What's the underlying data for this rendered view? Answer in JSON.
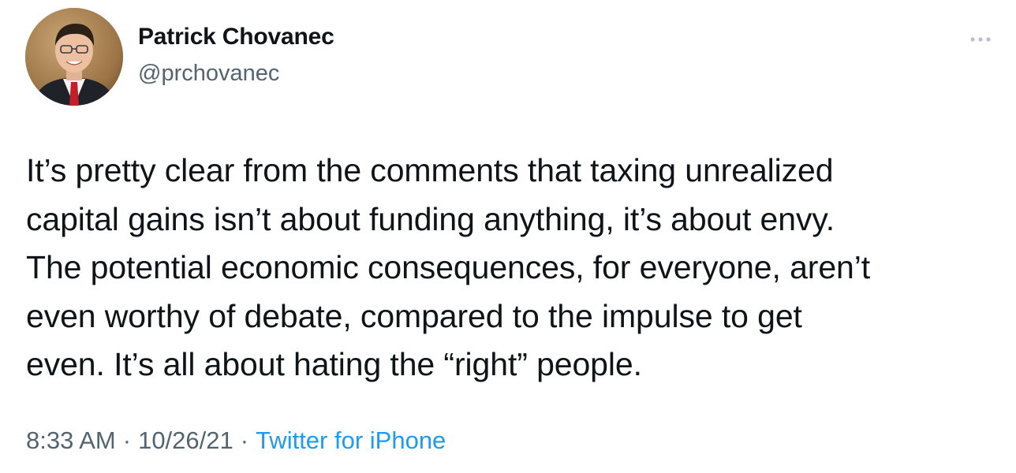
{
  "author": {
    "name": "Patrick Chovanec",
    "handle": "@prchovanec"
  },
  "tweet": {
    "lines": [
      "It’s pretty clear from the comments that taxing unrealized",
      "capital gains isn’t about funding anything, it’s about envy.",
      "The potential economic consequences, for everyone, aren’t",
      "even worthy of debate, compared to the impulse to get",
      "even. It’s all about hating the “right” people."
    ]
  },
  "meta": {
    "time": "8:33 AM",
    "separator": "·",
    "date": "10/26/21",
    "source": "Twitter for iPhone"
  },
  "icons": {
    "more": "more-horizontal-icon"
  },
  "colors": {
    "text": "#0f1419",
    "secondary": "#536471",
    "link": "#1d9bf0"
  }
}
